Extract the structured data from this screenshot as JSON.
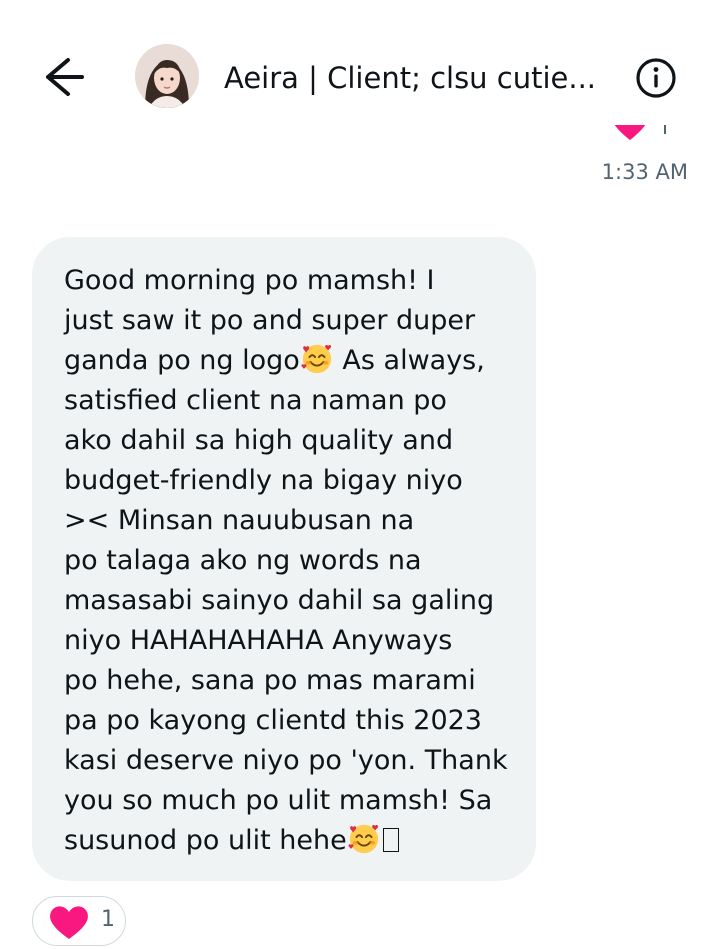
{
  "header": {
    "back_icon": "arrow-left-icon",
    "avatar_icon": "user-avatar",
    "title": "Aeira | Client; clsu cutie...",
    "info_icon": "info-icon"
  },
  "thread": {
    "previous_message_reaction_icon": "heart-icon",
    "timestamp": "1:33 AM"
  },
  "message": {
    "lines": [
      "Good morning po mamsh! I",
      "just saw it po and super duper",
      "ganda po ng logo",
      " As always,",
      "satisfied client na naman po",
      "ako dahil sa high quality and",
      "budget-friendly na bigay niyo",
      ">< Minsan nauubusan na",
      "po talaga ako ng words na",
      "masasabi sainyo dahil sa galing",
      "niyo HAHAHAHAHA Anyways",
      "po hehe, sana po mas marami",
      "pa po kayong clientd this 2023",
      "kasi deserve niyo po 'yon. Thank",
      "you so much po ulit mamsh! Sa",
      "susunod po ulit hehe"
    ],
    "emoji_icon": "smiling-face-with-hearts-icon"
  },
  "reaction": {
    "icon": "heart-icon",
    "count": "1"
  },
  "colors": {
    "bubble_bg": "#eff3f4",
    "heart": "#f91880",
    "text": "#0f1419",
    "muted": "#536471"
  }
}
